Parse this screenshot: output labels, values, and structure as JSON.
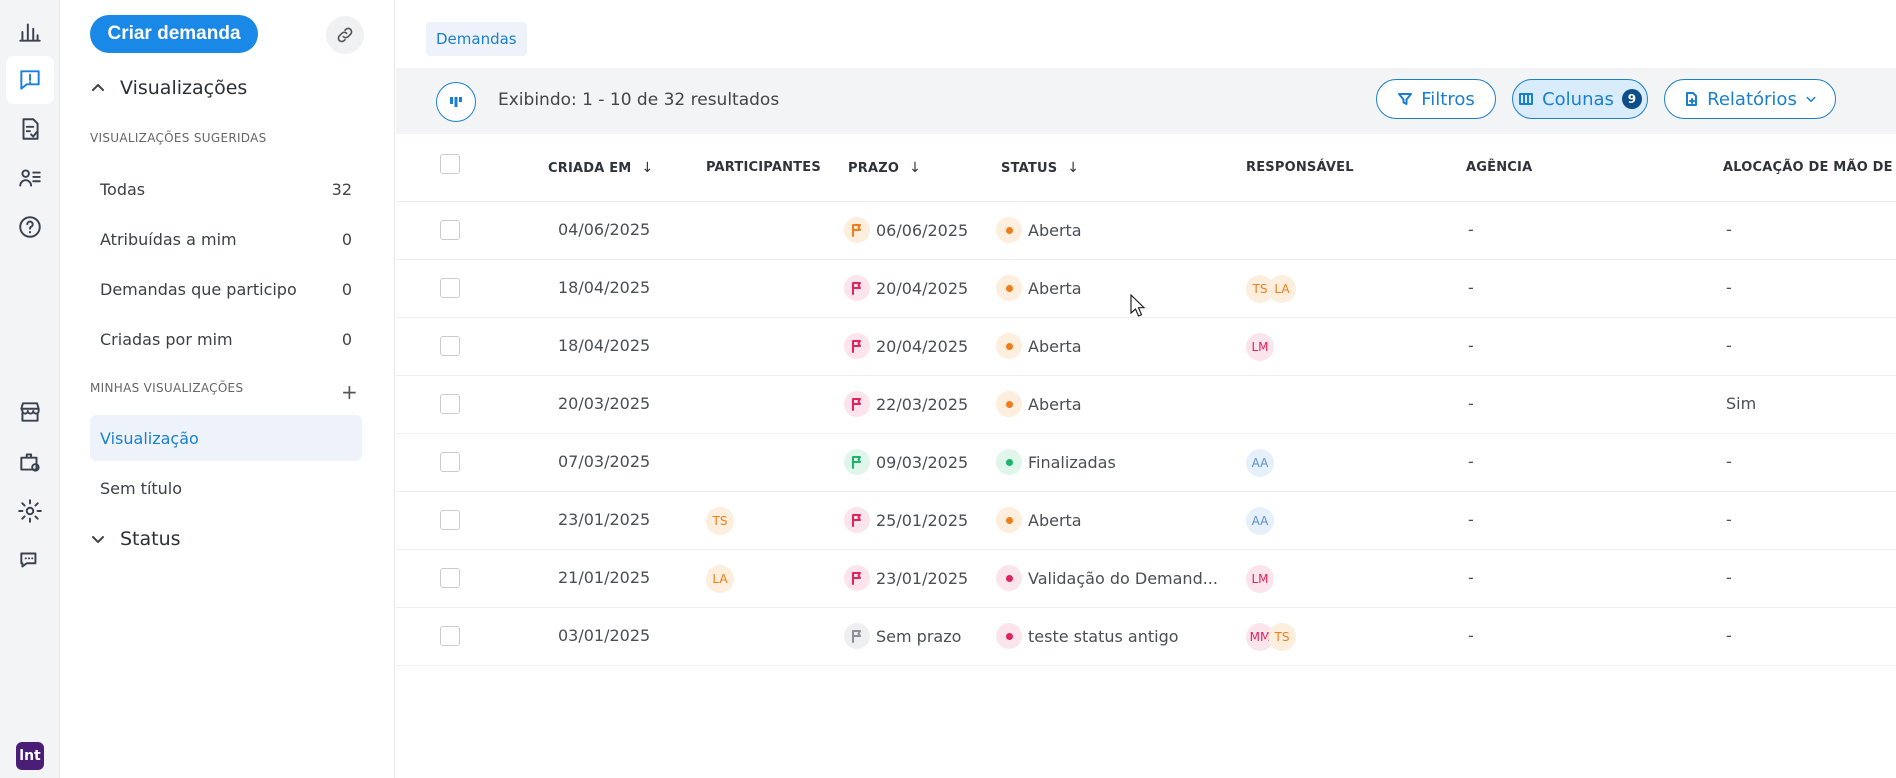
{
  "rail": {
    "icons": [
      "bar-chart-icon",
      "message-alert-icon",
      "form-check-icon",
      "user-list-icon",
      "help-circle-icon",
      "store-icon",
      "briefcase-settings-icon",
      "gear-icon",
      "chat-bubbles-icon"
    ],
    "logo_text": "lnt"
  },
  "sidebar": {
    "create_label": "Criar demanda",
    "visualizations_title": "Visualizações",
    "suggested_label": "VISUALIZAÇÕES SUGERIDAS",
    "suggested": [
      {
        "label": "Todas",
        "count": "32"
      },
      {
        "label": "Atribuídas a mim",
        "count": "0"
      },
      {
        "label": "Demandas que participo",
        "count": "0"
      },
      {
        "label": "Criadas por mim",
        "count": "0"
      }
    ],
    "mine_label": "MINHAS VISUALIZAÇÕES",
    "mine": [
      {
        "label": "Visualização"
      },
      {
        "label": "Sem título"
      }
    ],
    "status_title": "Status"
  },
  "main": {
    "tab": "Demandas",
    "showing": "Exibindo: 1 - 10 de 32 resultados",
    "filters_label": "Filtros",
    "columns_label": "Colunas",
    "columns_count": "9",
    "reports_label": "Relatórios"
  },
  "table": {
    "headers": {
      "created": "CRIADA EM",
      "participants": "PARTICIPANTES",
      "deadline": "PRAZO",
      "status": "STATUS",
      "responsible": "RESPONSÁVEL",
      "agency": "AGÊNCIA",
      "allocation": "ALOCAÇÃO DE MÃO DE OB"
    },
    "sort_arrow": "↓",
    "rows": [
      {
        "created": "04/06/2025",
        "participants": [],
        "deadline": "06/06/2025",
        "flag": "orange",
        "status": "Aberta",
        "status_color": "orange",
        "responsible": [],
        "agency": "-",
        "allocation": "-"
      },
      {
        "created": "18/04/2025",
        "participants": [],
        "deadline": "20/04/2025",
        "flag": "red",
        "status": "Aberta",
        "status_color": "orange",
        "responsible": [
          {
            "t": "TS",
            "c": "orange"
          },
          {
            "t": "LA",
            "c": "orange"
          }
        ],
        "agency": "-",
        "allocation": "-"
      },
      {
        "created": "18/04/2025",
        "participants": [],
        "deadline": "20/04/2025",
        "flag": "red",
        "status": "Aberta",
        "status_color": "orange",
        "responsible": [
          {
            "t": "LM",
            "c": "red"
          }
        ],
        "agency": "-",
        "allocation": "-"
      },
      {
        "created": "20/03/2025",
        "participants": [],
        "deadline": "22/03/2025",
        "flag": "red",
        "status": "Aberta",
        "status_color": "orange",
        "responsible": [],
        "agency": "-",
        "allocation": "Sim"
      },
      {
        "created": "07/03/2025",
        "participants": [],
        "deadline": "09/03/2025",
        "flag": "green",
        "status": "Finalizadas",
        "status_color": "green",
        "responsible": [
          {
            "t": "AA",
            "c": "blue"
          }
        ],
        "agency": "-",
        "allocation": "-"
      },
      {
        "created": "23/01/2025",
        "participants": [
          {
            "t": "TS",
            "c": "orange"
          }
        ],
        "deadline": "25/01/2025",
        "flag": "red",
        "status": "Aberta",
        "status_color": "orange",
        "responsible": [
          {
            "t": "AA",
            "c": "blue"
          }
        ],
        "agency": "-",
        "allocation": "-"
      },
      {
        "created": "21/01/2025",
        "participants": [
          {
            "t": "LA",
            "c": "orange"
          }
        ],
        "deadline": "23/01/2025",
        "flag": "red",
        "status": "Validação do Demand...",
        "status_color": "red",
        "responsible": [
          {
            "t": "LM",
            "c": "red"
          }
        ],
        "agency": "-",
        "allocation": "-"
      },
      {
        "created": "03/01/2025",
        "participants": [],
        "deadline": "Sem prazo",
        "flag": "gray",
        "status": "teste status antigo",
        "status_color": "red",
        "responsible": [
          {
            "t": "MM",
            "c": "red"
          },
          {
            "t": "TS",
            "c": "orange"
          }
        ],
        "agency": "-",
        "allocation": "-"
      }
    ]
  },
  "colors": {
    "accent": "#1a88e6",
    "orange": "#f07d1a",
    "red": "#e0245e",
    "green": "#1cb36a",
    "gray": "#8a8f98",
    "blue": "#5a8fc9"
  }
}
